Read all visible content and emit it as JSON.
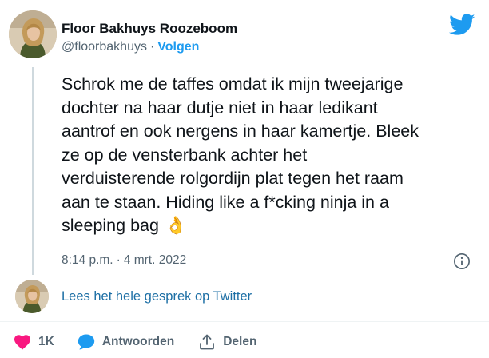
{
  "author": {
    "display_name": "Floor Bakhuys Roozeboom",
    "handle": "@floorbakhuys",
    "separator": "·",
    "follow_label": "Volgen"
  },
  "tweet": {
    "text": "Schrok me de taffes omdat ik mijn tweejarige\ndochter na haar dutje niet in haar ledikant\naantrof en ook nergens in haar kamertje. Bleek\nze op de vensterbank achter het\nverduisterende rolgordijn plat tegen het raam\naan te staan. Hiding like a f*cking ninja in a\nsleeping bag",
    "emoji": "👌",
    "time": "8:14 p.m.",
    "separator": "·",
    "date": "4 mrt. 2022"
  },
  "read_thread_label": "Lees het hele gesprek op Twitter",
  "actions": {
    "like_count": "1K",
    "reply_label": "Antwoorden",
    "share_label": "Delen"
  },
  "colors": {
    "accent": "#1d9bf0",
    "like": "#f91880",
    "text": "#0f1419",
    "secondary": "#536471"
  },
  "icons": {
    "brand": "twitter-bird-icon",
    "info": "info-icon",
    "like": "heart-icon",
    "reply": "speech-bubble-icon",
    "share": "share-upload-icon"
  }
}
